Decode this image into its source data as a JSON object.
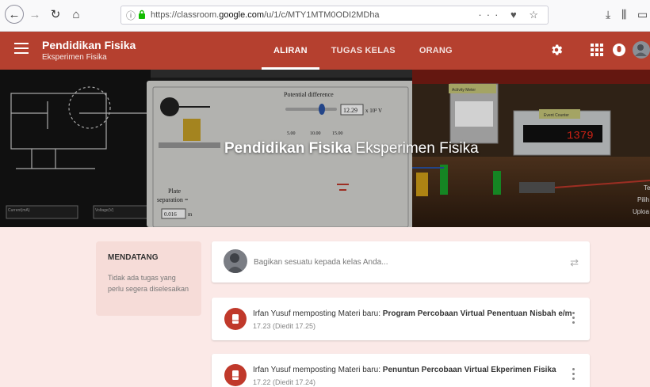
{
  "browser": {
    "url_prefix": "https://classroom.",
    "url_domain": "google.com",
    "url_path": "/u/1/c/MTY1MTM0ODI2MDha",
    "url_actions": "··· ♥ ☆",
    "download_icon": "⤓",
    "library_icon": "⫼",
    "sidebar_icon": "▭"
  },
  "app": {
    "class_name": "Pendidikan Fisika",
    "class_section": "Eksperimen Fisika",
    "tabs": [
      {
        "label": "ALIRAN",
        "active": true
      },
      {
        "label": "TUGAS KELAS",
        "active": false
      },
      {
        "label": "ORANG",
        "active": false
      }
    ],
    "accent_color": "#b5402f"
  },
  "banner": {
    "title": "Pendidikan Fisika",
    "subtitle": "Eksperimen Fisika",
    "sim_heading": "Potential difference",
    "sim_value": "12.29",
    "sim_unit": "x 10³ V",
    "sim_ticks": [
      "5.00",
      "10.00",
      "15.00"
    ],
    "sim_plate_label": "Plate",
    "sim_separation_label": "separation =",
    "sim_separation_value": "0.016",
    "sim_separation_unit": "m",
    "sim_meter_label": "Activity Meter",
    "sim_counter_label": "Event Counter",
    "sim_counter_value": "1379",
    "sim_current_label": "Current(mA)",
    "sim_voltage_label": "Voltage(V)",
    "sim_right_text": [
      "Te",
      "Pilih",
      "Uploa"
    ]
  },
  "upcoming": {
    "title": "MENDATANG",
    "text": "Tidak ada tugas yang perlu segera diselesaikan"
  },
  "share": {
    "placeholder": "Bagikan sesuatu kepada kelas Anda..."
  },
  "posts": [
    {
      "prefix": "Irfan Yusuf memposting Materi baru: ",
      "title": "Program Percobaan Virtual Penentuan Nisbah e/m",
      "time": "17.23 (Diedit 17.25)"
    },
    {
      "prefix": "Irfan Yusuf memposting Materi baru: ",
      "title": "Penuntun Percobaan Virtual Ekperimen Fisika",
      "time": "17.22 (Diedit 17.24)"
    }
  ]
}
